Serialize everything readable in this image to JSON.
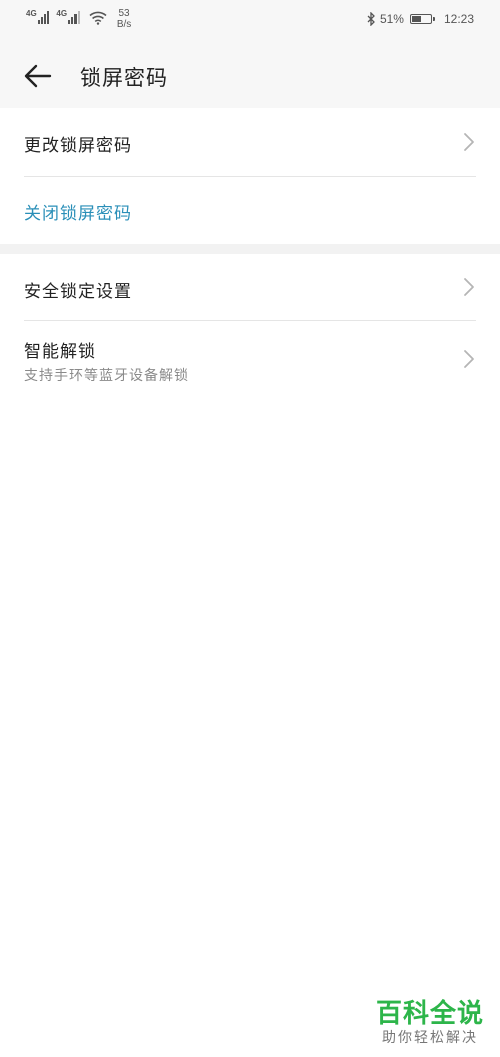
{
  "status_bar": {
    "net1_label": "4G",
    "net2_label": "4G",
    "speed_value": "53",
    "speed_unit": "B/s",
    "battery_percent_text": "51%",
    "battery_level": 0.51,
    "time": "12:23",
    "icons": [
      "signal-icon",
      "wifi-icon",
      "bluetooth-icon",
      "battery-icon"
    ]
  },
  "header": {
    "title": "锁屏密码",
    "back_icon": "arrow-left-icon"
  },
  "section1": {
    "items": [
      {
        "label": "更改锁屏密码",
        "has_chevron": true
      },
      {
        "label": "关闭锁屏密码",
        "has_chevron": false
      }
    ]
  },
  "section2": {
    "items": [
      {
        "label": "安全锁定设置",
        "has_chevron": true
      },
      {
        "label": "智能解锁",
        "sub": "支持手环等蓝牙设备解锁",
        "has_chevron": true
      }
    ]
  },
  "watermark": {
    "title": "百科全说",
    "subtitle": "助你轻松解决"
  },
  "colors": {
    "accent_blue": "#2a8fb8",
    "watermark_green": "#2db54a",
    "header_bg": "#f7f7f7"
  }
}
